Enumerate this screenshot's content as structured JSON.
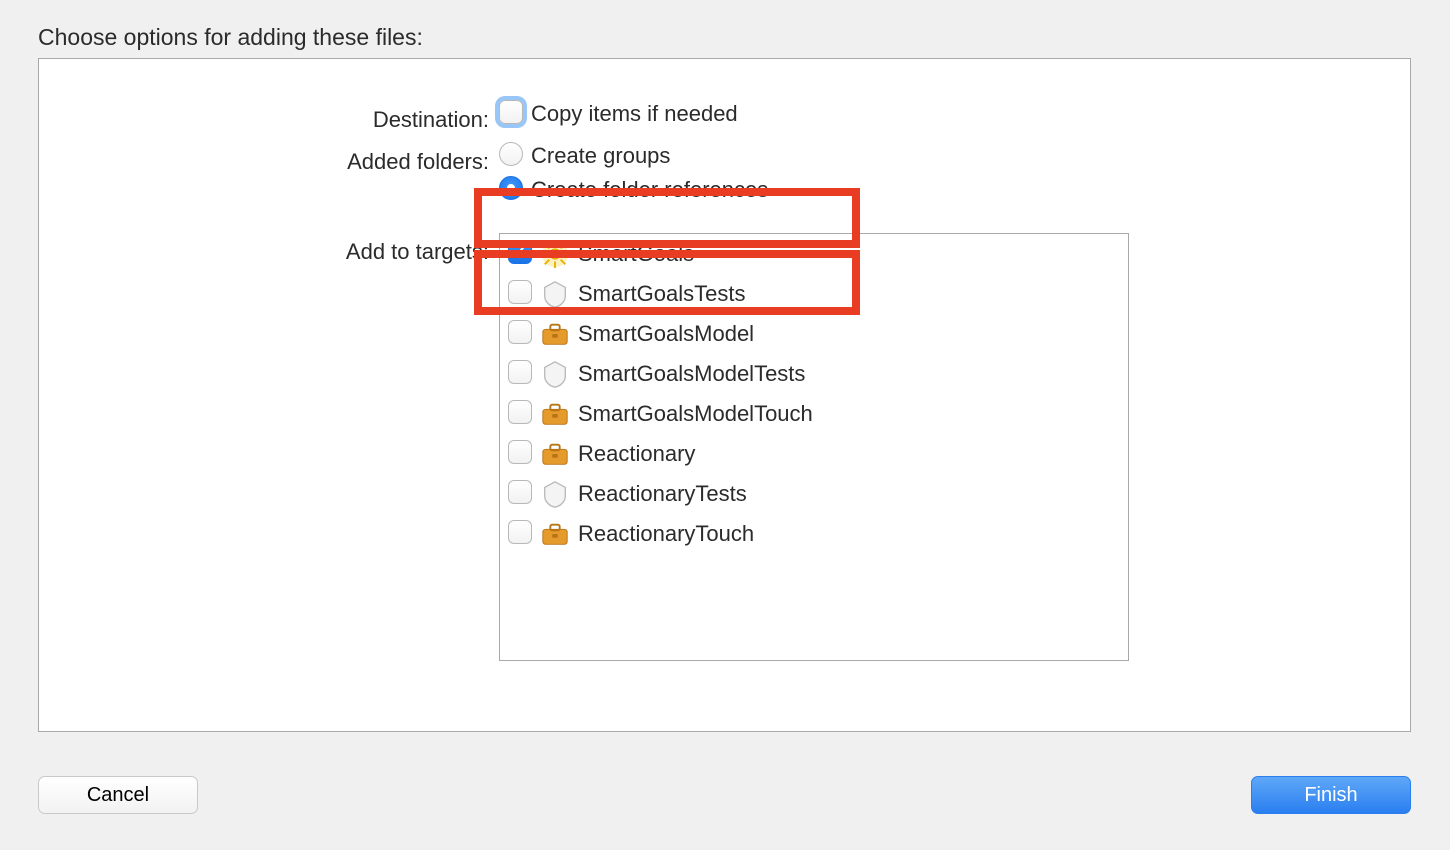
{
  "title": "Choose options for adding these files:",
  "labels": {
    "destination": "Destination:",
    "added_folders": "Added folders:",
    "add_to_targets": "Add to targets:"
  },
  "destination": {
    "copy_label": "Copy items if needed",
    "copy_checked": false
  },
  "added_folders": {
    "groups_label": "Create groups",
    "references_label": "Create folder references",
    "selected": "references"
  },
  "targets": [
    {
      "name": "SmartGoals",
      "checked": true,
      "icon": "app"
    },
    {
      "name": "SmartGoalsTests",
      "checked": false,
      "icon": "test"
    },
    {
      "name": "SmartGoalsModel",
      "checked": false,
      "icon": "briefcase"
    },
    {
      "name": "SmartGoalsModelTests",
      "checked": false,
      "icon": "test"
    },
    {
      "name": "SmartGoalsModelTouch",
      "checked": false,
      "icon": "briefcase"
    },
    {
      "name": "Reactionary",
      "checked": false,
      "icon": "briefcase"
    },
    {
      "name": "ReactionaryTests",
      "checked": false,
      "icon": "test"
    },
    {
      "name": "ReactionaryTouch",
      "checked": false,
      "icon": "briefcase"
    }
  ],
  "buttons": {
    "cancel": "Cancel",
    "finish": "Finish"
  }
}
